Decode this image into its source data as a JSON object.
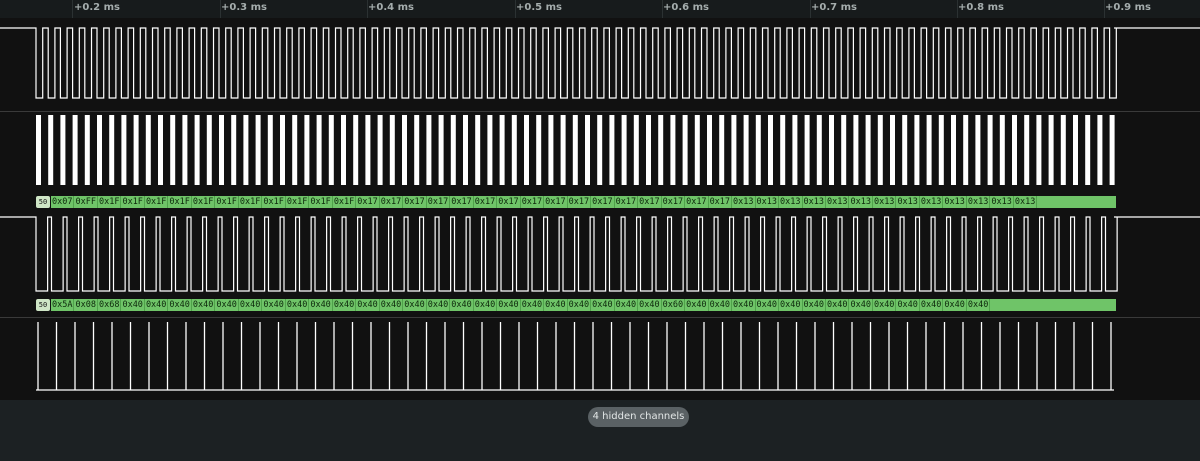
{
  "ruler": {
    "ticks": [
      "+0.2 ms",
      "+0.3 ms",
      "+0.4 ms",
      "+0.5 ms",
      "+0.6 ms",
      "+0.7 ms",
      "+0.8 ms",
      "+0.9 ms"
    ]
  },
  "channels": [
    {
      "id": "ch0",
      "kind": "digital"
    },
    {
      "id": "ch1",
      "kind": "digital"
    },
    {
      "id": "ch2",
      "kind": "digital"
    },
    {
      "id": "ch3",
      "kind": "digital"
    }
  ],
  "decoders": [
    {
      "address": "50",
      "bytes": [
        "0x07",
        "0xFF",
        "0x1F",
        "0x1F",
        "0x1F",
        "0x1F",
        "0x1F",
        "0x1F",
        "0x1F",
        "0x1F",
        "0x1F",
        "0x1F",
        "0x1F",
        "0x17",
        "0x17",
        "0x17",
        "0x17",
        "0x17",
        "0x17",
        "0x17",
        "0x17",
        "0x17",
        "0x17",
        "0x17",
        "0x17",
        "0x17",
        "0x17",
        "0x17",
        "0x17",
        "0x13",
        "0x13",
        "0x13",
        "0x13",
        "0x13",
        "0x13",
        "0x13",
        "0x13",
        "0x13",
        "0x13",
        "0x13",
        "0x13",
        "0x13"
      ]
    },
    {
      "address": "50",
      "bytes": [
        "0x5A",
        "0x08",
        "0x68",
        "0x40",
        "0x40",
        "0x40",
        "0x40",
        "0x40",
        "0x40",
        "0x40",
        "0x40",
        "0x40",
        "0x40",
        "0x40",
        "0x40",
        "0x40",
        "0x40",
        "0x40",
        "0x40",
        "0x40",
        "0x40",
        "0x40",
        "0x40",
        "0x40",
        "0x40",
        "0x40",
        "0x60",
        "0x40",
        "0x40",
        "0x40",
        "0x40",
        "0x40",
        "0x40",
        "0x40",
        "0x40",
        "0x40",
        "0x40",
        "0x40",
        "0x40",
        "0x40"
      ]
    }
  ],
  "footer": {
    "hidden_channels_label": "4 hidden channels"
  },
  "colors": {
    "background": "#111111",
    "signal": "#ffffff",
    "decoder_fill": "#6fc468",
    "decoder_address": "#cfe6c6",
    "pill": "#5a6164"
  }
}
